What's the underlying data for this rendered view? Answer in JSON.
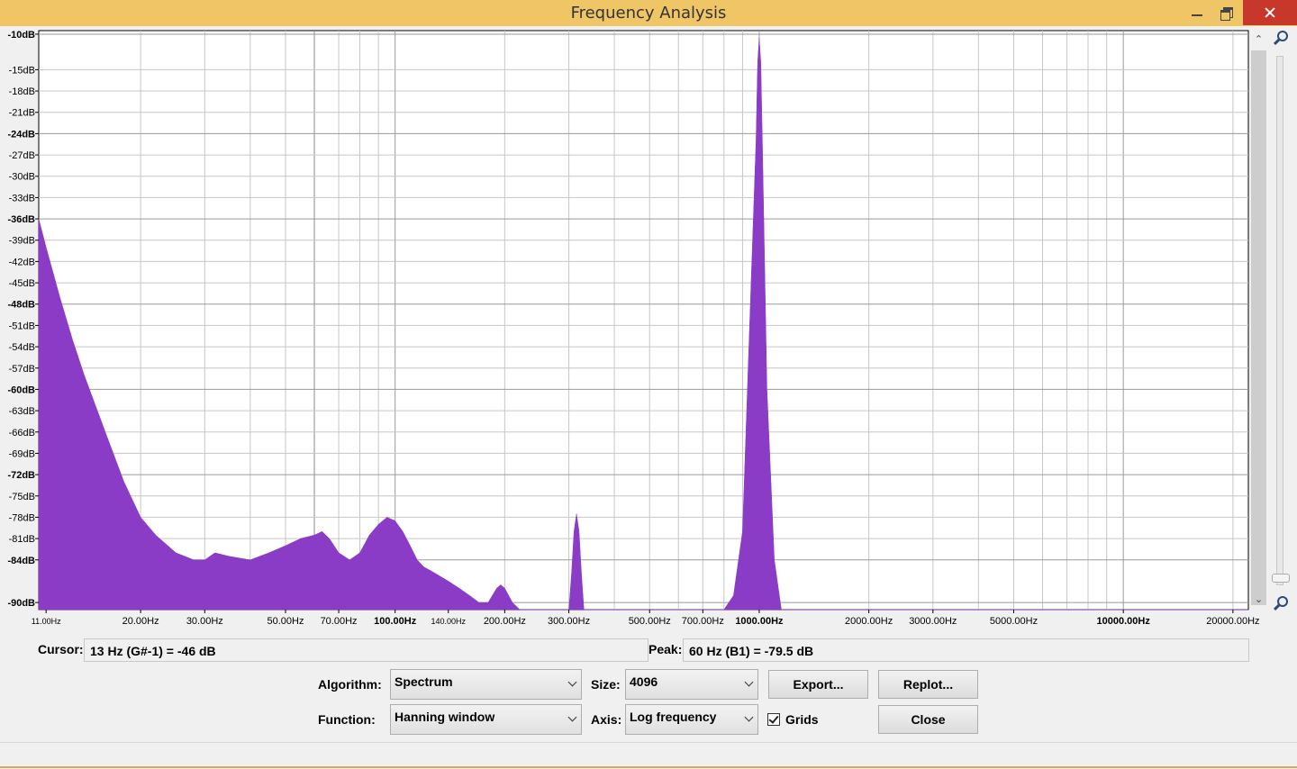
{
  "window": {
    "title": "Frequency Analysis"
  },
  "chart_data": {
    "type": "area",
    "title": "",
    "xlabel": "",
    "ylabel": "",
    "x_scale": "log",
    "xlim": [
      10.5,
      22050
    ],
    "ylim": [
      -91,
      -9.5
    ],
    "grid": true,
    "fill_color": "#8a3cc6",
    "y_ticks": [
      -10,
      -15,
      -18,
      -21,
      -24,
      -27,
      -30,
      -33,
      -36,
      -39,
      -42,
      -45,
      -48,
      -51,
      -54,
      -57,
      -60,
      -63,
      -66,
      -69,
      -72,
      -75,
      -78,
      -81,
      -84,
      -90
    ],
    "y_tick_labels": [
      "-10dB",
      "-15dB",
      "-18dB",
      "-21dB",
      "-24dB",
      "-27dB",
      "-30dB",
      "-33dB",
      "-36dB",
      "-39dB",
      "-42dB",
      "-45dB",
      "-48dB",
      "-51dB",
      "-54dB",
      "-57dB",
      "-60dB",
      "-63dB",
      "-66dB",
      "-69dB",
      "-72dB",
      "-75dB",
      "-78dB",
      "-81dB",
      "-84dB",
      "-90dB"
    ],
    "y_bold_ticks": [
      -10,
      -24,
      -36,
      -48,
      -60,
      -72,
      -84,
      -90
    ],
    "x_tick_labels": [
      {
        "hz": 11,
        "label": "11.00Hz",
        "size": "small"
      },
      {
        "hz": 20,
        "label": "20.00Hz"
      },
      {
        "hz": 30,
        "label": "30.00Hz"
      },
      {
        "hz": 50,
        "label": "50.00Hz"
      },
      {
        "hz": 70,
        "label": "70.00Hz"
      },
      {
        "hz": 100,
        "label": "100.00Hz",
        "bold": true
      },
      {
        "hz": 140,
        "label": "140.00Hz",
        "size": "small"
      },
      {
        "hz": 200,
        "label": "200.00Hz"
      },
      {
        "hz": 300,
        "label": "300.00Hz"
      },
      {
        "hz": 500,
        "label": "500.00Hz"
      },
      {
        "hz": 700,
        "label": "700.00Hz"
      },
      {
        "hz": 1000,
        "label": "1000.00Hz",
        "bold": true
      },
      {
        "hz": 2000,
        "label": "2000.00Hz"
      },
      {
        "hz": 3000,
        "label": "3000.00Hz"
      },
      {
        "hz": 5000,
        "label": "5000.00Hz"
      },
      {
        "hz": 10000,
        "label": "10000.00Hz",
        "bold": true
      },
      {
        "hz": 20000,
        "label": "20000.00Hz"
      }
    ],
    "series": [
      {
        "x": [
          10.5,
          11,
          12,
          13,
          14,
          16,
          18,
          20,
          22,
          25,
          28,
          30,
          32,
          35,
          40,
          45,
          50,
          55,
          60,
          63,
          66,
          70,
          75,
          80,
          85,
          90,
          95,
          100,
          105,
          110,
          115,
          120,
          125,
          130,
          140,
          150,
          160,
          170,
          180,
          185,
          190,
          195,
          200,
          205,
          210,
          220,
          300,
          305,
          310,
          315,
          320,
          325,
          330,
          800,
          850,
          900,
          950,
          980,
          990,
          1000,
          1010,
          1020,
          1050,
          1100,
          1150,
          22050
        ],
        "y": [
          -36,
          -40,
          -47,
          -53,
          -58,
          -66,
          -73,
          -78,
          -80.5,
          -83,
          -84,
          -84,
          -83,
          -83.5,
          -84,
          -83,
          -82,
          -81,
          -80.5,
          -80,
          -81,
          -83,
          -84,
          -83,
          -80.5,
          -79,
          -78,
          -78.5,
          -80,
          -82,
          -84,
          -85,
          -85.5,
          -86,
          -87,
          -88,
          -89,
          -90,
          -90,
          -89,
          -88,
          -87.5,
          -88,
          -89,
          -90,
          -91,
          -91,
          -86,
          -80,
          -77.5,
          -80,
          -86,
          -91,
          -91,
          -89,
          -80,
          -45,
          -25,
          -14,
          -10.5,
          -14,
          -25,
          -60,
          -84,
          -91,
          -91
        ]
      }
    ]
  },
  "status": {
    "cursor_label": "Cursor:",
    "cursor_value": "13 Hz (G#-1) = -46 dB",
    "peak_label": "Peak:",
    "peak_value": "60 Hz (B1) = -79.5 dB"
  },
  "controls": {
    "algorithm_label": "Algorithm:",
    "algorithm_value": "Spectrum",
    "size_label": "Size:",
    "size_value": "4096",
    "function_label": "Function:",
    "function_value": "Hanning window",
    "axis_label": "Axis:",
    "axis_value": "Log frequency",
    "grids_label": "Grids",
    "grids_checked": true,
    "export_label": "Export...",
    "replot_label": "Replot...",
    "close_label": "Close"
  },
  "icons": {
    "zoom_in": "zoom-in-icon",
    "zoom_out": "zoom-out-icon"
  }
}
